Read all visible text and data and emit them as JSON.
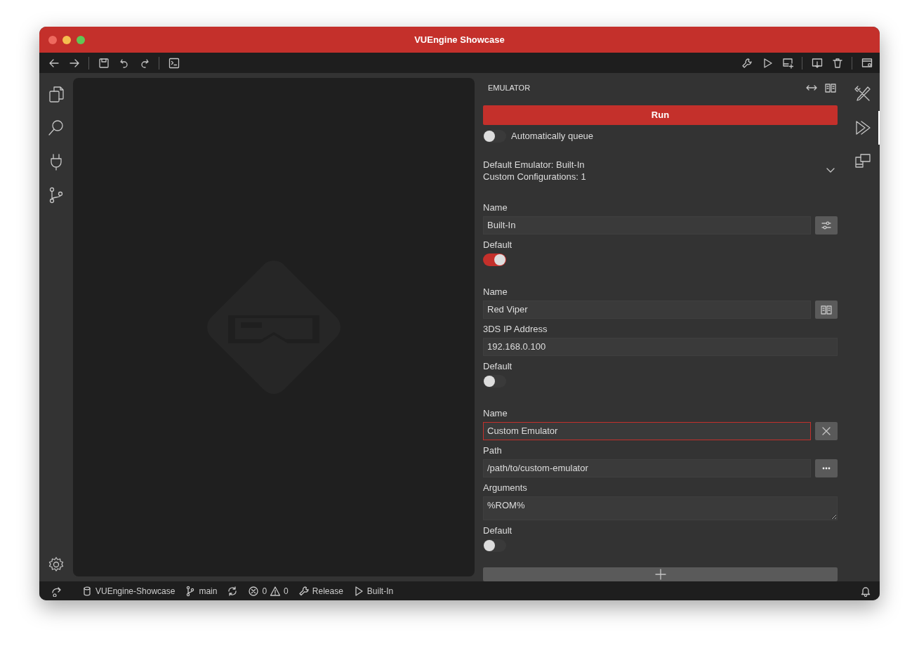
{
  "window": {
    "title": "VUEngine Showcase"
  },
  "activity_bar": {
    "items": [
      {
        "selected": false
      },
      {
        "selected": false
      },
      {
        "selected": false
      },
      {
        "selected": false
      }
    ]
  },
  "right_bar": {
    "items": [
      {
        "selected": false
      },
      {
        "selected": true
      },
      {
        "selected": false
      }
    ]
  },
  "panel": {
    "title": "EMULATOR",
    "run_button": "Run",
    "auto_queue": {
      "label": "Automatically queue",
      "on": false
    },
    "summary": {
      "lines": [
        "Default Emulator: Built-In",
        "Custom Configurations: 1"
      ],
      "expanded": true
    },
    "configurations": [
      {
        "kind": "built-in",
        "fields": [
          {
            "kind": "name",
            "label": "Name",
            "value": "Built-In",
            "focused": false
          },
          {
            "kind": "toggle",
            "label": "Default",
            "on": true
          }
        ]
      },
      {
        "kind": "red-viper",
        "fields": [
          {
            "kind": "name",
            "label": "Name",
            "value": "Red Viper",
            "focused": false
          },
          {
            "kind": "text",
            "label": "3DS IP Address",
            "value": "192.168.0.100"
          },
          {
            "kind": "toggle",
            "label": "Default",
            "on": false
          }
        ]
      },
      {
        "kind": "custom",
        "fields": [
          {
            "kind": "name",
            "label": "Name",
            "value": "Custom Emulator",
            "focused": true
          },
          {
            "kind": "path",
            "label": "Path",
            "value": "/path/to/custom-emulator"
          },
          {
            "kind": "textarea",
            "label": "Arguments",
            "value": "%ROM%"
          },
          {
            "kind": "toggle",
            "label": "Default",
            "on": false
          }
        ]
      }
    ]
  },
  "status_bar": {
    "items": [
      {
        "kind": "remote"
      },
      {
        "kind": "project",
        "text": "VUEngine-Showcase"
      },
      {
        "kind": "branch",
        "text": "main"
      },
      {
        "kind": "sync"
      },
      {
        "kind": "problems",
        "errors": "0",
        "warnings": "0"
      },
      {
        "kind": "build",
        "text": "Release"
      },
      {
        "kind": "emulator",
        "text": "Built-In"
      }
    ]
  }
}
